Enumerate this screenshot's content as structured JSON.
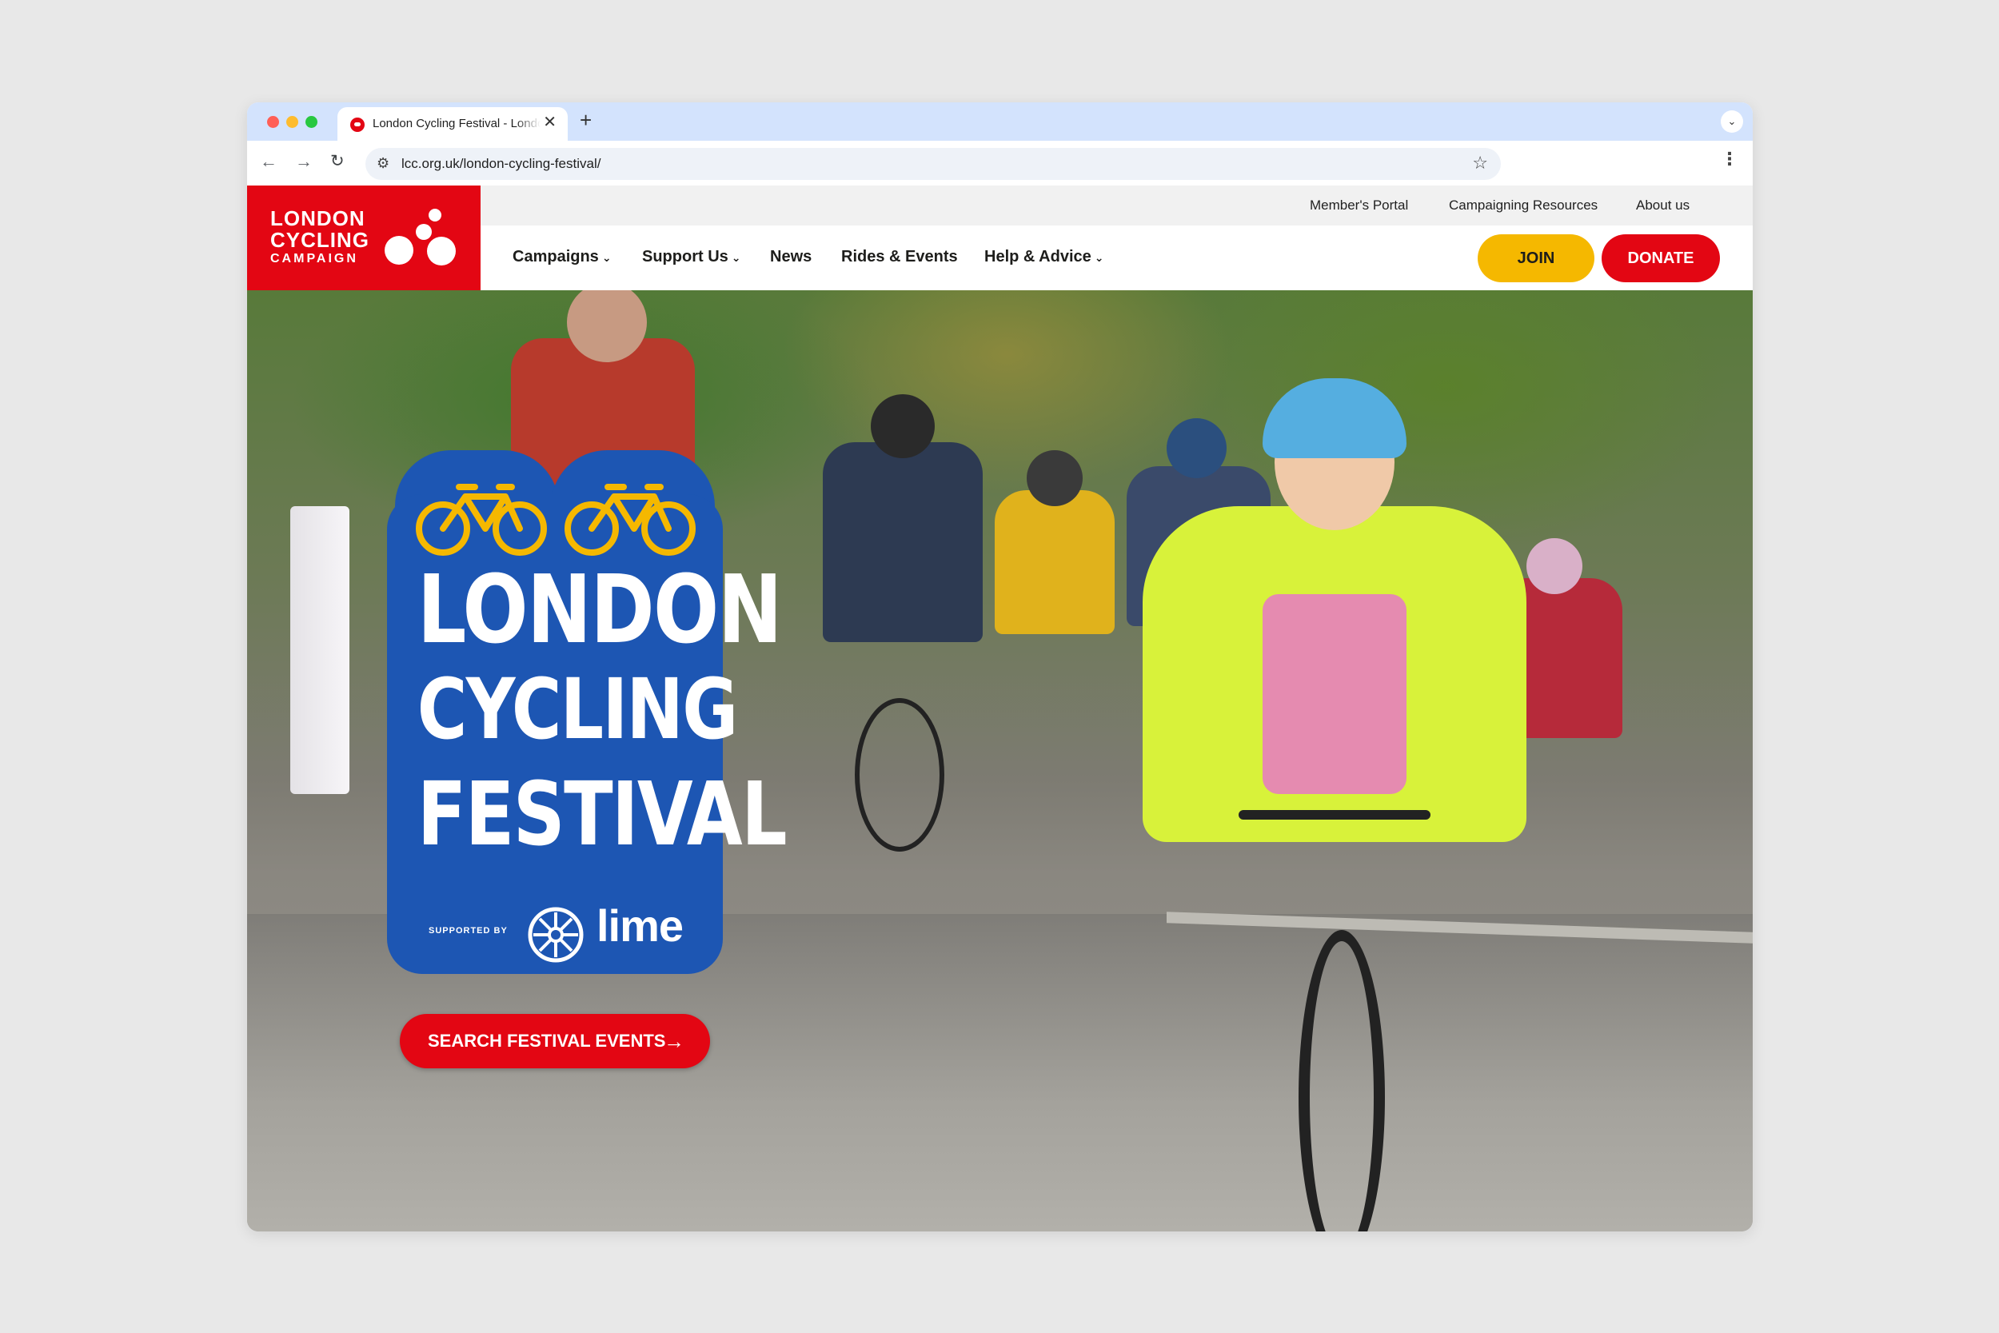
{
  "browser": {
    "tab_title": "London Cycling Festival - London Cycling Campaign",
    "tab_close": "✕",
    "new_tab": "+",
    "tab_menu": "⌄",
    "url": "lcc.org.uk/london-cycling-festival/",
    "icons": {
      "back": "←",
      "forward": "→",
      "reload": "↻",
      "site_info": "⚙",
      "star": "☆",
      "menu": "⋮"
    }
  },
  "site": {
    "logo": {
      "line1": "LONDON",
      "line2": "CYCLING",
      "line3": "CAMPAIGN",
      "color": "#e30613"
    },
    "top_links": [
      "Member's Portal",
      "Campaigning Resources",
      "About us"
    ],
    "nav": [
      {
        "label": "Campaigns",
        "dropdown": true
      },
      {
        "label": "Support Us",
        "dropdown": true
      },
      {
        "label": "News",
        "dropdown": false
      },
      {
        "label": "Rides & Events",
        "dropdown": false
      },
      {
        "label": "Help & Advice",
        "dropdown": true
      }
    ],
    "chevron": "⌄",
    "join_label": "JOIN",
    "donate_label": "DONATE",
    "join_color": "#f5b800",
    "donate_color": "#e30613"
  },
  "hero": {
    "festival": {
      "line1": "LONDON",
      "line2": "CYCLING",
      "line3": "FESTIVAL",
      "supported_by": "SUPPORTED BY",
      "sponsor": "lime",
      "badge_color": "#1d56b3",
      "bike_color": "#f5b800"
    },
    "cta_label": "SEARCH FESTIVAL EVENTS",
    "cta_arrow": "→"
  }
}
